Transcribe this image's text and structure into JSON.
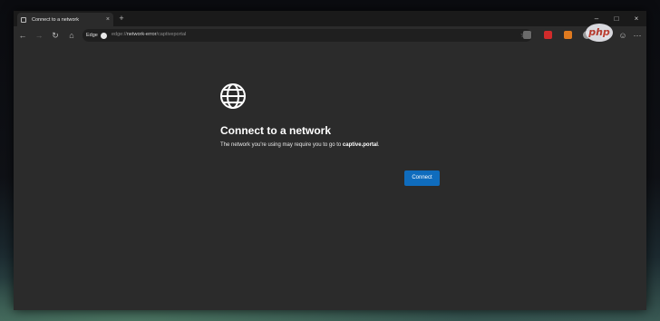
{
  "tab": {
    "title": "Connect to a network",
    "close": "×",
    "new_tab": "+"
  },
  "window": {
    "minimize": "–",
    "maximize": "□",
    "close": "×"
  },
  "toolbar": {
    "back_icon": "←",
    "forward_icon": "→",
    "refresh_icon": "↻",
    "home_icon": "⌂",
    "edge_label": "Edge",
    "url_scheme": "edge://",
    "url_host": "network-error",
    "url_path": "/captiveportal",
    "favorite_icon": "☆",
    "extensions": [
      {
        "name": "extension-1",
        "color": "#6a6a6a"
      },
      {
        "name": "extension-2",
        "color": "#d12b2b"
      },
      {
        "name": "extension-3",
        "color": "#e07a1f"
      },
      {
        "name": "extension-4",
        "color": "#9a9a9a"
      },
      {
        "name": "extension-5",
        "color": "#9a9a9a"
      }
    ],
    "settings_icon": "⋯"
  },
  "page": {
    "heading": "Connect to a network",
    "message_prefix": "The network you're using may require you to go to ",
    "message_host": "captive.portal",
    "message_suffix": ".",
    "connect_label": "Connect",
    "connect_color": "#0f6cbd"
  },
  "watermark": {
    "text": "php"
  }
}
